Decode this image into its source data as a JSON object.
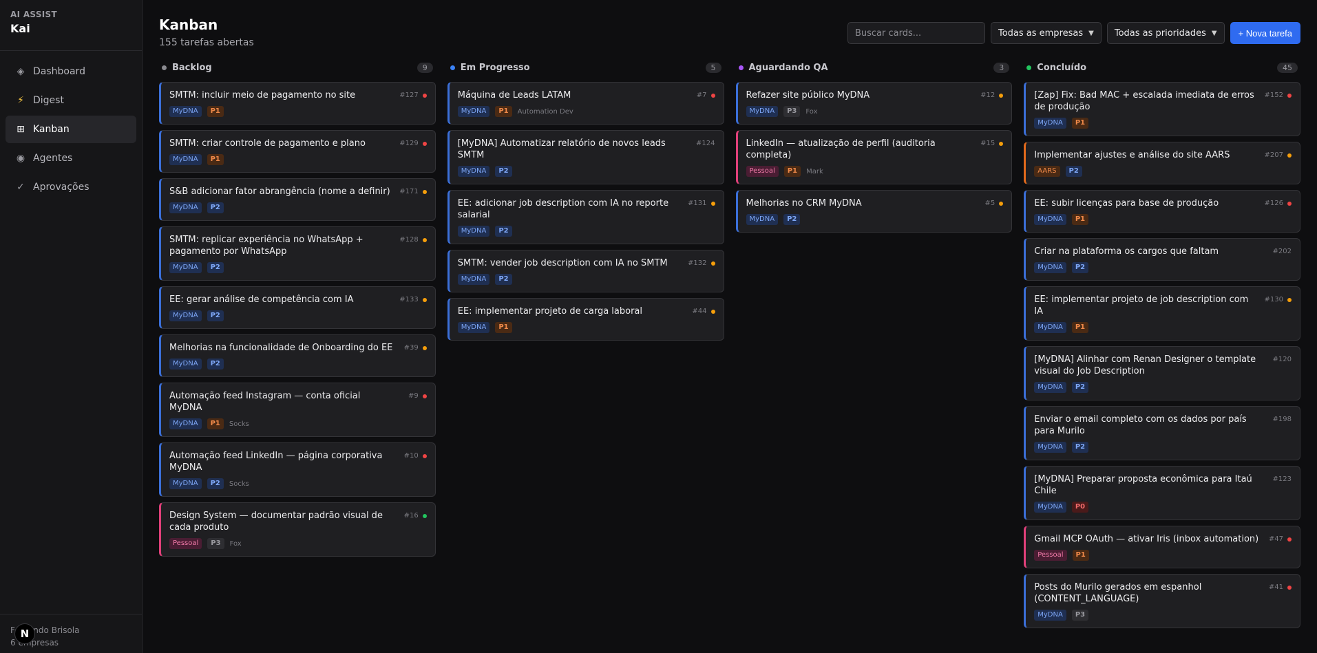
{
  "sidebar": {
    "brand_sub": "AI ASSIST",
    "brand_name": "Kai",
    "items": [
      {
        "icon": "diamond-icon",
        "glyph": "◈",
        "label": "Dashboard"
      },
      {
        "icon": "bolt-icon",
        "glyph": "⚡",
        "label": "Digest"
      },
      {
        "icon": "grid-icon",
        "glyph": "⊞",
        "label": "Kanban"
      },
      {
        "icon": "circle-dot-icon",
        "glyph": "◉",
        "label": "Agentes"
      },
      {
        "icon": "check-icon",
        "glyph": "✓",
        "label": "Aprovações"
      }
    ],
    "active_index": 2,
    "footer_name": "Fernando Brisola",
    "footer_sub": "6 empresas",
    "badge": "N"
  },
  "header": {
    "title": "Kanban",
    "subtitle": "155 tarefas abertas",
    "search_placeholder": "Buscar cards...",
    "company_filter": "Todas as empresas",
    "priority_filter": "Todas as prioridades",
    "new_task": "+ Nova tarefa"
  },
  "colors": {
    "backlog": "#8a8a90",
    "em_progresso": "#3b82f6",
    "aguardando": "#a855f7",
    "concluido": "#22c55e",
    "red": "#ef4444",
    "orange": "#f59e0b",
    "green": "#22c55e"
  },
  "columns": [
    {
      "title": "Backlog",
      "count": "9",
      "color": "#8a8a90",
      "cards": [
        {
          "title": "SMTM: incluir meio de pagamento no site",
          "id": "#127",
          "dot": "#ef4444",
          "company": "MyDNA",
          "prio": "P1",
          "assignee": "",
          "accent": "blue"
        },
        {
          "title": "SMTM: criar controle de pagamento e plano",
          "id": "#129",
          "dot": "#ef4444",
          "company": "MyDNA",
          "prio": "P1",
          "assignee": "",
          "accent": "blue"
        },
        {
          "title": "S&B adicionar fator abrangência (nome a definir)",
          "id": "#171",
          "dot": "#f59e0b",
          "company": "MyDNA",
          "prio": "P2",
          "assignee": "",
          "accent": "blue"
        },
        {
          "title": "SMTM: replicar experiência no WhatsApp + pagamento por WhatsApp",
          "id": "#128",
          "dot": "#f59e0b",
          "company": "MyDNA",
          "prio": "P2",
          "assignee": "",
          "accent": "blue"
        },
        {
          "title": "EE: gerar análise de competência com IA",
          "id": "#133",
          "dot": "#f59e0b",
          "company": "MyDNA",
          "prio": "P2",
          "assignee": "",
          "accent": "blue"
        },
        {
          "title": "Melhorias na funcionalidade de Onboarding do EE",
          "id": "#39",
          "dot": "#f59e0b",
          "company": "MyDNA",
          "prio": "P2",
          "assignee": "",
          "accent": "blue"
        },
        {
          "title": "Automação feed Instagram — conta oficial MyDNA",
          "id": "#9",
          "dot": "#ef4444",
          "company": "MyDNA",
          "prio": "P1",
          "assignee": "Socks",
          "accent": "blue"
        },
        {
          "title": "Automação feed LinkedIn — página corporativa MyDNA",
          "id": "#10",
          "dot": "#ef4444",
          "company": "MyDNA",
          "prio": "P2",
          "assignee": "Socks",
          "accent": "blue"
        },
        {
          "title": "Design System — documentar padrão visual de cada produto",
          "id": "#16",
          "dot": "#22c55e",
          "company": "Pessoal",
          "prio": "P3",
          "assignee": "Fox",
          "accent": "pink"
        }
      ]
    },
    {
      "title": "Em Progresso",
      "count": "5",
      "color": "#3b82f6",
      "cards": [
        {
          "title": "Máquina de Leads LATAM",
          "id": "#7",
          "dot": "#ef4444",
          "company": "MyDNA",
          "prio": "P1",
          "assignee": "Automation Dev",
          "accent": "blue"
        },
        {
          "title": "[MyDNA] Automatizar relatório de novos leads SMTM",
          "id": "#124",
          "dot": "",
          "company": "MyDNA",
          "prio": "P2",
          "assignee": "",
          "accent": "blue"
        },
        {
          "title": "EE: adicionar job description com IA no reporte salarial",
          "id": "#131",
          "dot": "#f59e0b",
          "company": "MyDNA",
          "prio": "P2",
          "assignee": "",
          "accent": "blue"
        },
        {
          "title": "SMTM: vender job description com IA no SMTM",
          "id": "#132",
          "dot": "#f59e0b",
          "company": "MyDNA",
          "prio": "P2",
          "assignee": "",
          "accent": "blue"
        },
        {
          "title": "EE: implementar projeto de carga laboral",
          "id": "#44",
          "dot": "#f59e0b",
          "company": "MyDNA",
          "prio": "P1",
          "assignee": "",
          "accent": "blue"
        }
      ]
    },
    {
      "title": "Aguardando QA",
      "count": "3",
      "color": "#a855f7",
      "cards": [
        {
          "title": "Refazer site público MyDNA",
          "id": "#12",
          "dot": "#f59e0b",
          "company": "MyDNA",
          "prio": "P3",
          "assignee": "Fox",
          "accent": "blue"
        },
        {
          "title": "LinkedIn — atualização de perfil (auditoria completa)",
          "id": "#15",
          "dot": "#f59e0b",
          "company": "Pessoal",
          "prio": "P1",
          "assignee": "Mark",
          "accent": "pink"
        },
        {
          "title": "Melhorias no CRM MyDNA",
          "id": "#5",
          "dot": "#f59e0b",
          "company": "MyDNA",
          "prio": "P2",
          "assignee": "",
          "accent": "blue"
        }
      ]
    },
    {
      "title": "Concluído",
      "count": "45",
      "color": "#22c55e",
      "cards": [
        {
          "title": "[Zap] Fix: Bad MAC + escalada imediata de erros de produção",
          "id": "#152",
          "dot": "#ef4444",
          "company": "MyDNA",
          "prio": "P1",
          "assignee": "",
          "accent": "blue"
        },
        {
          "title": "Implementar ajustes e análise do site AARS",
          "id": "#207",
          "dot": "#f59e0b",
          "company": "AARS",
          "prio": "P2",
          "assignee": "",
          "accent": "orange"
        },
        {
          "title": "EE: subir licenças para base de produção",
          "id": "#126",
          "dot": "#ef4444",
          "company": "MyDNA",
          "prio": "P1",
          "assignee": "",
          "accent": "blue"
        },
        {
          "title": "Criar na plataforma os cargos que faltam",
          "id": "#202",
          "dot": "",
          "company": "MyDNA",
          "prio": "P2",
          "assignee": "",
          "accent": "blue"
        },
        {
          "title": "EE: implementar projeto de job description com IA",
          "id": "#130",
          "dot": "#f59e0b",
          "company": "MyDNA",
          "prio": "P1",
          "assignee": "",
          "accent": "blue"
        },
        {
          "title": "[MyDNA] Alinhar com Renan Designer o template visual do Job Description",
          "id": "#120",
          "dot": "",
          "company": "MyDNA",
          "prio": "P2",
          "assignee": "",
          "accent": "blue"
        },
        {
          "title": "Enviar o email completo com os dados por país para Murilo",
          "id": "#198",
          "dot": "",
          "company": "MyDNA",
          "prio": "P2",
          "assignee": "",
          "accent": "blue"
        },
        {
          "title": "[MyDNA] Preparar proposta econômica para Itaú Chile",
          "id": "#123",
          "dot": "",
          "company": "MyDNA",
          "prio": "P0",
          "assignee": "",
          "accent": "blue"
        },
        {
          "title": "Gmail MCP OAuth — ativar Iris (inbox automation)",
          "id": "#47",
          "dot": "#ef4444",
          "company": "Pessoal",
          "prio": "P1",
          "assignee": "",
          "accent": "pink"
        },
        {
          "title": "Posts do Murilo gerados em espanhol (CONTENT_LANGUAGE)",
          "id": "#41",
          "dot": "#ef4444",
          "company": "MyDNA",
          "prio": "P3",
          "assignee": "",
          "accent": "blue"
        }
      ]
    }
  ]
}
